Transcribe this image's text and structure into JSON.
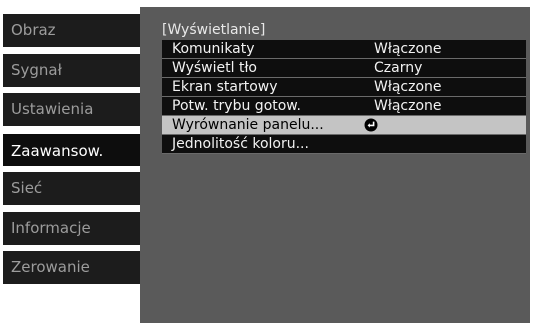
{
  "sidebar": {
    "items": [
      {
        "label": "Obraz"
      },
      {
        "label": "Sygnał"
      },
      {
        "label": "Ustawienia"
      },
      {
        "label": "Zaawansow."
      },
      {
        "label": "Sieć"
      },
      {
        "label": "Informacje"
      },
      {
        "label": "Zerowanie"
      }
    ],
    "active": "Zaawansow."
  },
  "panel": {
    "title": "[Wyświetlanie]",
    "rows": [
      {
        "label": "Komunikaty",
        "value": "Włączone"
      },
      {
        "label": "Wyświetl tło",
        "value": "Czarny"
      },
      {
        "label": "Ekran startowy",
        "value": "Włączone"
      },
      {
        "label": "Potw. trybu gotow.",
        "value": "Włączone"
      },
      {
        "label": "Wyrównanie panelu...",
        "icon": "enter-icon",
        "selected": true
      },
      {
        "label": "Jednolitość koloru..."
      }
    ]
  },
  "colors": {
    "panel_bg": "#5a5a5a",
    "row_bg": "#0e0e0e",
    "selected_bg": "#c4c4c4",
    "nav_bg": "#1c1c1c",
    "nav_text": "#9c9c9c"
  }
}
